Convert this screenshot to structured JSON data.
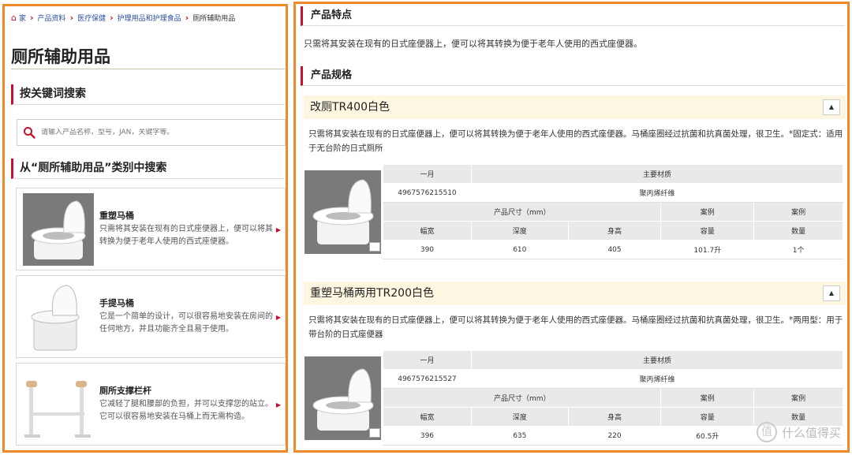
{
  "breadcrumb": {
    "items": [
      "家",
      "产品资料",
      "医疗保健",
      "护理用品和护理食品",
      "厕所辅助用品"
    ]
  },
  "left": {
    "title": "厕所辅助用品",
    "keyword_section": "按关键词搜索",
    "search_placeholder": "请输入产品名称，型号，JAN，关键字等。",
    "category_section": "从“厕所辅助用品”类别中搜索",
    "categories": [
      {
        "title": "重塑马桶",
        "desc": "只需将其安装在现有的日式座便器上，便可以将其转换为便于老年人使用的西式座便器。"
      },
      {
        "title": "手提马桶",
        "desc": "它是一个简单的设计，可以很容易地安装在房间的任何地方，并且功能齐全且易于使用。"
      },
      {
        "title": "厕所支撑栏杆",
        "desc": "它减轻了腿和腰部的负担，并可以支撑您的站立。它可以很容易地安装在马桶上而无需构造。"
      }
    ]
  },
  "right": {
    "features_head": "产品特点",
    "features_text": "只需将其安装在现有的日式座便器上，便可以将其转换为便于老年人使用的西式座便器。",
    "spec_head": "产品规格",
    "labels": {
      "jan": "一月",
      "material": "主要材质",
      "size": "产品尺寸（mm）",
      "width": "幅宽",
      "depth": "深度",
      "height": "身高",
      "case": "案例",
      "capacity": "容量",
      "quantity": "数量"
    },
    "products": [
      {
        "name": "改厕TR400白色",
        "desc": "只需将其安装在现有的日式座便器上，便可以将其转换为便于老年人使用的西式座便器。马桶座圈经过抗菌和抗真菌处理，很卫生。*固定式：适用于无台阶的日式厕所",
        "jan": "4967576215510",
        "material": "聚丙烯纤维",
        "width": "390",
        "depth": "610",
        "height": "405",
        "capacity": "101.7升",
        "quantity": "1个"
      },
      {
        "name": "重塑马桶两用TR200白色",
        "desc": "只需将其安装在现有的日式座便器上，便可以将其转换为便于老年人使用的西式座便器。马桶座圈经过抗菌和抗真菌处理，很卫生。*两用型：用于带台阶的日式座便器",
        "jan": "4967576215527",
        "material": "聚丙烯纤维",
        "width": "396",
        "depth": "635",
        "height": "220",
        "capacity": "60.5升",
        "quantity": ""
      }
    ],
    "watermark": "什么值得买",
    "watermark_glyph": "值"
  },
  "colors": {
    "accent": "#c8102e",
    "frame": "#f0892c",
    "product_bar": "#fdf6e0"
  }
}
